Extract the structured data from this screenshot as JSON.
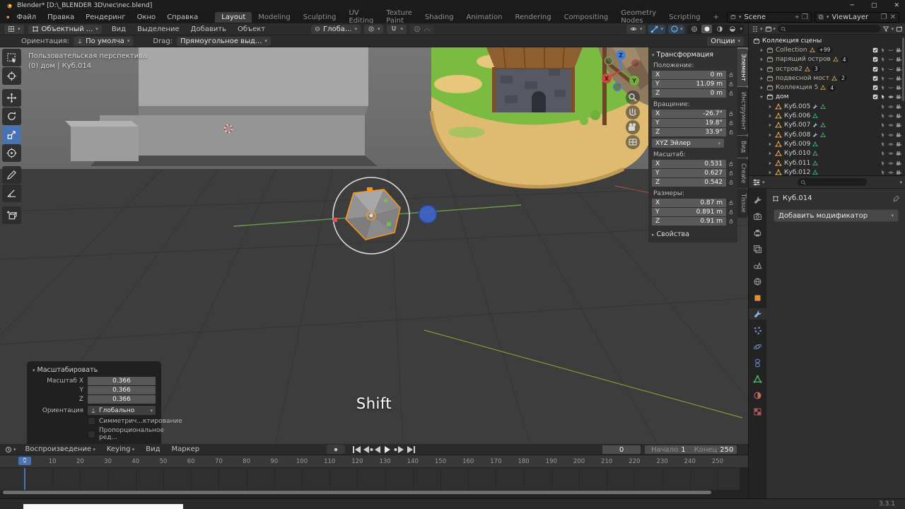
{
  "window": {
    "title": "Blender* [D:\\_BLENDER 3D\\nec\\nec.blend]"
  },
  "topbar": {
    "menus": [
      "Файл",
      "Правка",
      "Рендеринг",
      "Окно",
      "Справка"
    ],
    "workspaces": [
      "Layout",
      "Modeling",
      "Sculpting",
      "UV Editing",
      "Texture Paint",
      "Shading",
      "Animation",
      "Rendering",
      "Compositing",
      "Geometry Nodes",
      "Scripting",
      "+"
    ],
    "active_workspace": "Layout",
    "scene": "Scene",
    "viewlayer": "ViewLayer"
  },
  "viewport_header": {
    "mode": "Объектный ...",
    "menus": [
      "Вид",
      "Выделение",
      "Добавить",
      "Объект"
    ],
    "orientation": "Глоба..."
  },
  "tool_settings": {
    "orientation_label": "Ориентация:",
    "orientation_value": "По умолча",
    "drag_label": "Drag:",
    "drag_value": "Прямоугольное выд...",
    "options": "Опции"
  },
  "viewport": {
    "view_label": "Пользовательская перспектива",
    "context_label": "(0) дом | Куб.014",
    "screencast_key": "Shift",
    "gizmo_axes": {
      "x": "X",
      "y": "Y",
      "z": "Z"
    }
  },
  "toolbar": {
    "tools": [
      {
        "name": "select-box",
        "active": false
      },
      {
        "name": "cursor",
        "active": false
      },
      {
        "name": "move",
        "active": false
      },
      {
        "name": "rotate",
        "active": false
      },
      {
        "name": "scale",
        "active": true
      },
      {
        "name": "transform",
        "active": false
      },
      {
        "name": "annotate",
        "active": false
      },
      {
        "name": "measure",
        "active": false
      },
      {
        "name": "add-cube",
        "active": false
      }
    ]
  },
  "npanel": {
    "title": "Трансформация",
    "tabs": [
      {
        "label": "Элемент",
        "active": true
      },
      {
        "label": "Инструмент",
        "active": false
      },
      {
        "label": "Вид",
        "active": false
      },
      {
        "label": "Create",
        "active": false
      },
      {
        "label": "Tissue",
        "active": false
      }
    ],
    "groups": [
      {
        "label": "Положение:",
        "rows": [
          {
            "axis": "X",
            "value": "0 m"
          },
          {
            "axis": "Y",
            "value": "11.09 m"
          },
          {
            "axis": "Z",
            "value": "0 m"
          }
        ]
      },
      {
        "label": "Вращение:",
        "rows": [
          {
            "axis": "X",
            "value": "-26.7°"
          },
          {
            "axis": "Y",
            "value": "19.8°"
          },
          {
            "axis": "Z",
            "value": "33.9°"
          }
        ]
      },
      {
        "label": "Масштаб:",
        "rows": [
          {
            "axis": "X",
            "value": "0.531"
          },
          {
            "axis": "Y",
            "value": "0.627"
          },
          {
            "axis": "Z",
            "value": "0.542"
          }
        ]
      },
      {
        "label": "Размеры:",
        "rows": [
          {
            "axis": "X",
            "value": "0.87 m"
          },
          {
            "axis": "Y",
            "value": "0.891 m"
          },
          {
            "axis": "Z",
            "value": "0.91 m"
          }
        ]
      }
    ],
    "rotation_mode": "XYZ Эйлер",
    "properties_collapsed": "Свойства"
  },
  "outliner": {
    "root": "Коллекция сцены",
    "collections": [
      {
        "name": "Collection",
        "badge": "+99",
        "expanded": false
      },
      {
        "name": "парящий остров",
        "badge": "4",
        "expanded": false
      },
      {
        "name": "остров2",
        "badge": "3",
        "expanded": false
      },
      {
        "name": "подвесной мост",
        "badge": "2",
        "expanded": false
      },
      {
        "name": "Коллекция 5",
        "badge": "4",
        "expanded": false
      },
      {
        "name": "дом",
        "badge": "",
        "expanded": true
      }
    ],
    "objects": [
      {
        "name": "Куб.005",
        "modifier": true
      },
      {
        "name": "Куб.006",
        "modifier": false
      },
      {
        "name": "Куб.007",
        "modifier": true
      },
      {
        "name": "Куб.008",
        "modifier": true
      },
      {
        "name": "Куб.009",
        "modifier": false
      },
      {
        "name": "Куб.010",
        "modifier": false
      },
      {
        "name": "Куб.011",
        "modifier": false
      },
      {
        "name": "Куб.012",
        "modifier": false
      }
    ]
  },
  "properties": {
    "breadcrumb": "Куб.014",
    "add_modifier": "Добавить модификатор",
    "tabs": [
      {
        "name": "tool",
        "color": "#9e9e9e",
        "active": false
      },
      {
        "name": "render",
        "color": "#9e9e9e",
        "active": false
      },
      {
        "name": "output",
        "color": "#9e9e9e",
        "active": false
      },
      {
        "name": "view-layer",
        "color": "#9e9e9e",
        "active": false
      },
      {
        "name": "scene",
        "color": "#9e9e9e",
        "active": false
      },
      {
        "name": "world",
        "color": "#9e9e9e",
        "active": false
      },
      {
        "name": "object",
        "color": "#e0903c",
        "active": false
      },
      {
        "name": "modifiers",
        "color": "#84b3e8",
        "active": true
      },
      {
        "name": "particles",
        "color": "#6f93c4",
        "active": false
      },
      {
        "name": "physics",
        "color": "#6f93c4",
        "active": false
      },
      {
        "name": "constraints",
        "color": "#6f93c4",
        "active": false
      },
      {
        "name": "object-data",
        "color": "#4fae7a",
        "active": false
      },
      {
        "name": "material",
        "color": "#c66a5a",
        "active": false
      },
      {
        "name": "texture",
        "color": "#b0575a",
        "active": false
      }
    ]
  },
  "operator_panel": {
    "title": "Масштабировать",
    "fields": [
      {
        "label": "Масштаб X",
        "value": "0.366"
      },
      {
        "label": "Y",
        "value": "0.366"
      },
      {
        "label": "Z",
        "value": "0.366"
      }
    ],
    "orientation_label": "Ориентация",
    "orientation_value": "Глобально",
    "checkboxes": [
      "Симметрич...ктирование",
      "Пропорциональное ред..."
    ]
  },
  "timeline": {
    "menus": [
      "Воспроизведение",
      "Keying",
      "Вид",
      "Маркер"
    ],
    "current_frame": "0",
    "start_label": "Начало",
    "start_value": "1",
    "end_label": "Конец",
    "end_value": "250",
    "ticks": [
      0,
      10,
      20,
      30,
      40,
      50,
      60,
      70,
      80,
      90,
      100,
      110,
      120,
      130,
      140,
      150,
      160,
      170,
      180,
      190,
      200,
      210,
      220,
      230,
      240,
      250
    ]
  },
  "statusbar": {
    "version": "3.3.1"
  },
  "colors": {
    "accent": "#4772b3",
    "selection_orange": "#f7941d"
  }
}
